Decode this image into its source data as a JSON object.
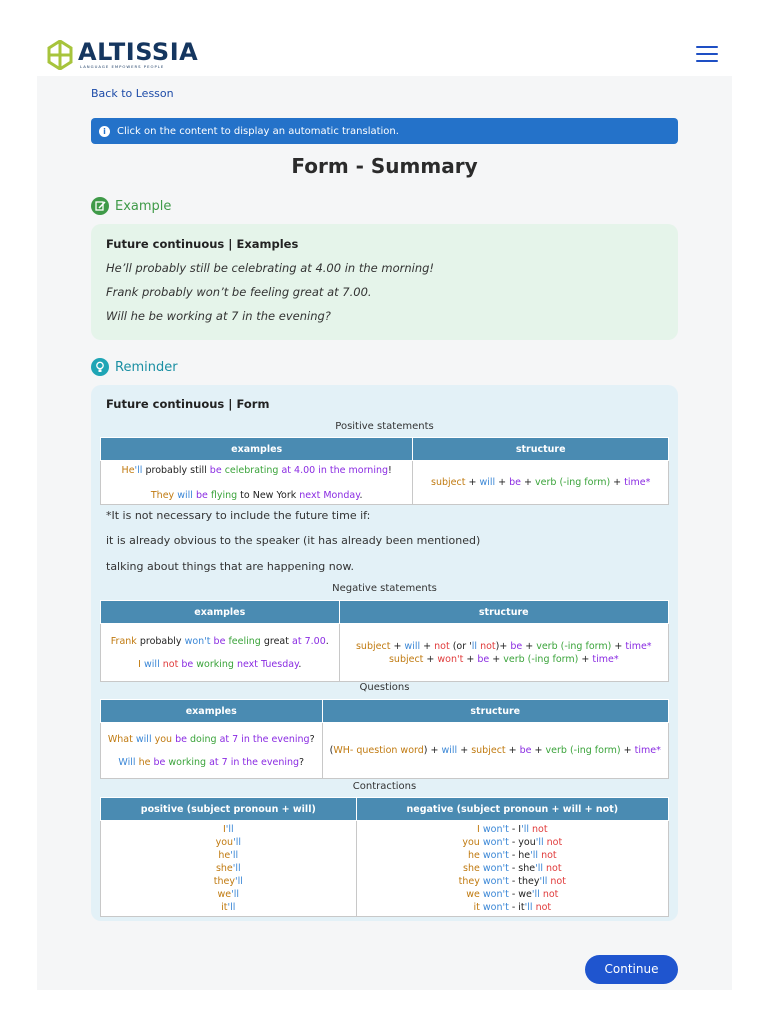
{
  "brand": {
    "name": "ALTISSIA",
    "tagline": "LANGUAGE EMPOWERS PEOPLE"
  },
  "nav": {
    "back": "Back to Lesson"
  },
  "info": {
    "text": "Click on the content to display an automatic translation."
  },
  "title": "Form - Summary",
  "example": {
    "heading": "Example",
    "box_title": "Future continuous | Examples",
    "lines": [
      "He’ll probably still be celebrating at 4.00 in the morning!",
      "Frank probably won’t be feeling great at 7.00.",
      "Will he be working at 7 in the evening?"
    ]
  },
  "reminder": {
    "heading": "Reminder",
    "box_title": "Future continuous | Form",
    "positive_caption": "Positive statements",
    "negative_caption": "Negative statements",
    "questions_caption": "Questions",
    "contractions_caption": "Contractions",
    "col_examples": "examples",
    "col_structure": "structure",
    "notes": [
      "*It is not necessary to include the future time if:",
      "it is already obvious to the speaker (it has already been mentioned)",
      "talking about things that are happening now."
    ],
    "contr_pos_header": "positive (subject pronoun + will)",
    "contr_neg_header": "negative (subject pronoun + will + not)",
    "contr_pos": [
      "I'll",
      "you'll",
      "he'll",
      "she'll",
      "they'll",
      "we'll",
      "it'll"
    ],
    "contr_neg": [
      {
        "s": "I",
        "c": "I'll"
      },
      {
        "s": "you",
        "c": "you'll"
      },
      {
        "s": "he",
        "c": "he'll"
      },
      {
        "s": "she",
        "c": "she'll"
      },
      {
        "s": "they",
        "c": "they'll"
      },
      {
        "s": "we",
        "c": "we'll"
      },
      {
        "s": "it",
        "c": "it'll"
      }
    ]
  },
  "continue_label": "Continue",
  "colors": {
    "accent": "#1f55cf",
    "info": "#2472c9",
    "table_header": "#4a8bb2",
    "example_bg": "#e5f4ea",
    "reminder_bg": "#e3f1f7"
  }
}
